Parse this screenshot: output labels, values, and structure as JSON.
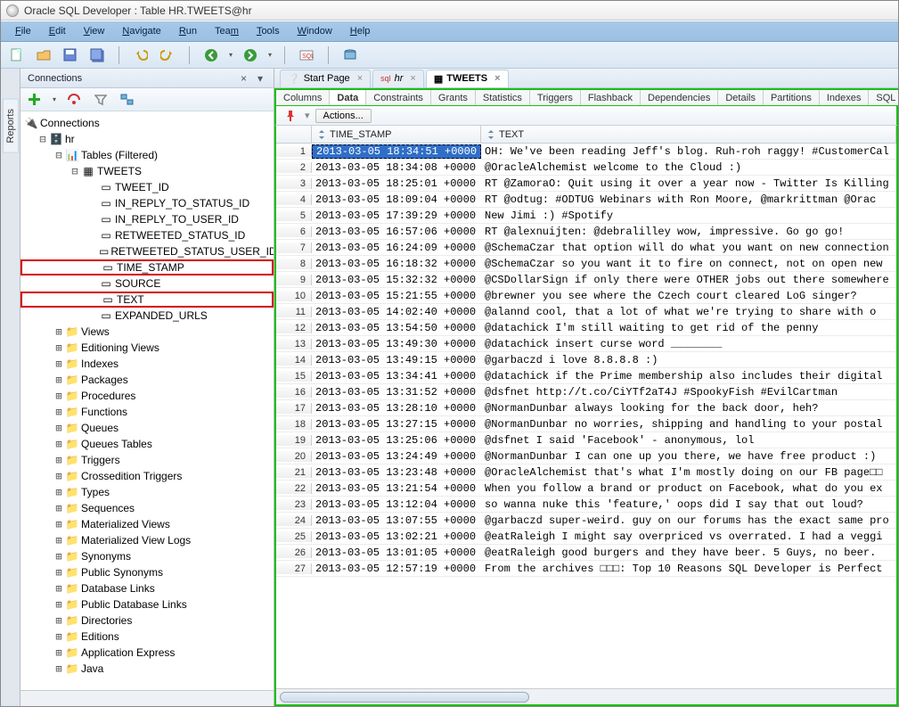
{
  "window": {
    "title": "Oracle SQL Developer : Table HR.TWEETS@hr"
  },
  "menus": {
    "file": "File",
    "edit": "Edit",
    "view": "View",
    "navigate": "Navigate",
    "run": "Run",
    "team": "Team",
    "tools": "Tools",
    "window": "Window",
    "help": "Help"
  },
  "left_tabs": {
    "reports": "Reports"
  },
  "connections": {
    "title": "Connections",
    "root": "Connections",
    "db": "hr",
    "tables_label": "Tables (Filtered)",
    "tweets": "TWEETS",
    "cols": {
      "tweet_id": "TWEET_ID",
      "in_reply_to_status_id": "IN_REPLY_TO_STATUS_ID",
      "in_reply_to_user_id": "IN_REPLY_TO_USER_ID",
      "retweeted_status_id": "RETWEETED_STATUS_ID",
      "retweeted_status_user_id": "RETWEETED_STATUS_USER_ID",
      "time_stamp": "TIME_STAMP",
      "source": "SOURCE",
      "text": "TEXT",
      "expanded_urls": "EXPANDED_URLS"
    },
    "folders": {
      "views": "Views",
      "editioning_views": "Editioning Views",
      "indexes": "Indexes",
      "packages": "Packages",
      "procedures": "Procedures",
      "functions": "Functions",
      "queues": "Queues",
      "queues_tables": "Queues Tables",
      "triggers": "Triggers",
      "crossedition_triggers": "Crossedition Triggers",
      "types": "Types",
      "sequences": "Sequences",
      "materialized_views": "Materialized Views",
      "materialized_view_logs": "Materialized View Logs",
      "synonyms": "Synonyms",
      "public_synonyms": "Public Synonyms",
      "database_links": "Database Links",
      "public_database_links": "Public Database Links",
      "directories": "Directories",
      "editions": "Editions",
      "application_express": "Application Express",
      "java": "Java"
    }
  },
  "doc_tabs": {
    "start": "Start Page",
    "hr": "hr",
    "tweets": "TWEETS"
  },
  "sub_tabs": {
    "columns": "Columns",
    "data": "Data",
    "constraints": "Constraints",
    "grants": "Grants",
    "statistics": "Statistics",
    "triggers": "Triggers",
    "flashback": "Flashback",
    "dependencies": "Dependencies",
    "details": "Details",
    "partitions": "Partitions",
    "indexes": "Indexes",
    "sql": "SQL"
  },
  "grid": {
    "actions": "Actions...",
    "col_ts": "TIME_STAMP",
    "col_tx": "TEXT",
    "rows": [
      {
        "ts": "2013-03-05 18:34:51 +0000",
        "tx": "OH: We've been reading Jeff's blog. Ruh-roh raggy! #CustomerCal"
      },
      {
        "ts": "2013-03-05 18:34:08 +0000",
        "tx": "@OracleAlchemist welcome to the Cloud :)"
      },
      {
        "ts": "2013-03-05 18:25:01 +0000",
        "tx": "RT @ZamoraO: Quit using it over a year now - Twitter Is Killing"
      },
      {
        "ts": "2013-03-05 18:09:04 +0000",
        "tx": "RT @odtug: #ODTUG Webinars with Ron Moore, @markrittman @Orac"
      },
      {
        "ts": "2013-03-05 17:39:29 +0000",
        "tx": "New Jimi :) #Spotify"
      },
      {
        "ts": "2013-03-05 16:57:06 +0000",
        "tx": "RT @alexnuijten: @debralilley wow, impressive. Go go go!"
      },
      {
        "ts": "2013-03-05 16:24:09 +0000",
        "tx": "@SchemaCzar that option will do what you want on new connection"
      },
      {
        "ts": "2013-03-05 16:18:32 +0000",
        "tx": "@SchemaCzar so you want it to fire on connect, not on open new"
      },
      {
        "ts": "2013-03-05 15:32:32 +0000",
        "tx": "@CSDollarSign if only there were OTHER jobs out there somewhere"
      },
      {
        "ts": "2013-03-05 15:21:55 +0000",
        "tx": "@brewner you see where the Czech court cleared LoG singer?"
      },
      {
        "ts": "2013-03-05 14:02:40 +0000",
        "tx": "@alannd cool, that a lot of what we're trying to share with o"
      },
      {
        "ts": "2013-03-05 13:54:50 +0000",
        "tx": "@datachick I'm still waiting to get rid of the penny"
      },
      {
        "ts": "2013-03-05 13:49:30 +0000",
        "tx": "@datachick insert curse word ________"
      },
      {
        "ts": "2013-03-05 13:49:15 +0000",
        "tx": "@garbaczd i love 8.8.8.8 :)"
      },
      {
        "ts": "2013-03-05 13:34:41 +0000",
        "tx": "@datachick if the Prime membership also includes their digital"
      },
      {
        "ts": "2013-03-05 13:31:52 +0000",
        "tx": "@dsfnet http://t.co/CiYTf2aT4J #SpookyFish #EvilCartman"
      },
      {
        "ts": "2013-03-05 13:28:10 +0000",
        "tx": "@NormanDunbar always looking for the back door, heh?"
      },
      {
        "ts": "2013-03-05 13:27:15 +0000",
        "tx": "@NormanDunbar no worries, shipping and handling to your postal"
      },
      {
        "ts": "2013-03-05 13:25:06 +0000",
        "tx": "@dsfnet I said 'Facebook' - anonymous, lol"
      },
      {
        "ts": "2013-03-05 13:24:49 +0000",
        "tx": "@NormanDunbar I can one up you there, we have free product :)"
      },
      {
        "ts": "2013-03-05 13:23:48 +0000",
        "tx": "@OracleAlchemist that's what I'm mostly doing on our FB page□□"
      },
      {
        "ts": "2013-03-05 13:21:54 +0000",
        "tx": "When you follow a brand or product on Facebook, what do you ex"
      },
      {
        "ts": "2013-03-05 13:12:04 +0000",
        "tx": "so wanna nuke this 'feature,' oops did I say that out loud?"
      },
      {
        "ts": "2013-03-05 13:07:55 +0000",
        "tx": "@garbaczd super-weird. guy on our forums has the exact same pro"
      },
      {
        "ts": "2013-03-05 13:02:21 +0000",
        "tx": "@eatRaleigh I might say overpriced vs overrated. I had a veggi"
      },
      {
        "ts": "2013-03-05 13:01:05 +0000",
        "tx": "@eatRaleigh good burgers and they have beer. 5 Guys, no beer."
      },
      {
        "ts": "2013-03-05 12:57:19 +0000",
        "tx": "From the archives □□□: Top 10 Reasons SQL Developer is Perfect"
      }
    ]
  }
}
